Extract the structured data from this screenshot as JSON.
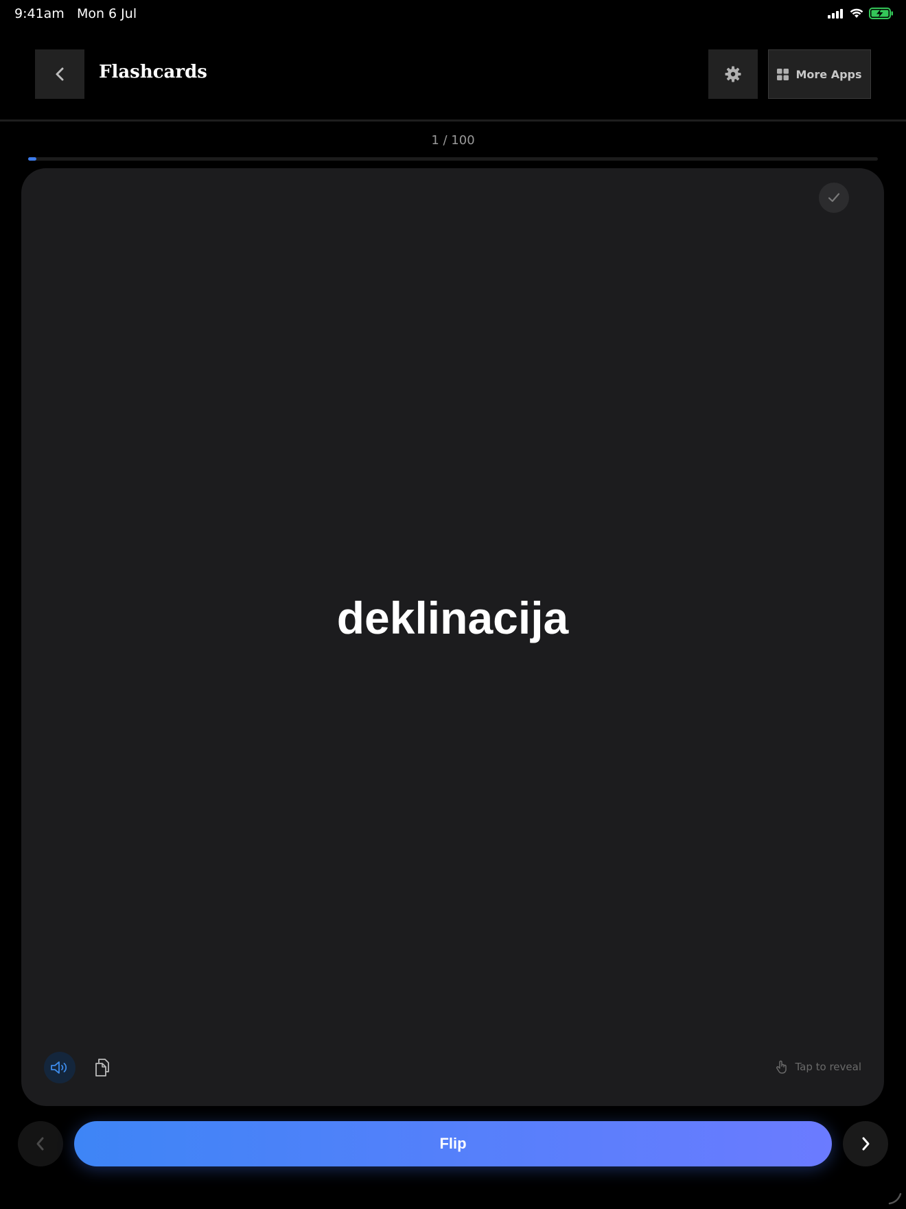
{
  "status_bar": {
    "time": "9:41am",
    "date": "Mon 6 Jul",
    "battery_color": "#34c759"
  },
  "header": {
    "title": "Flashcards",
    "more_apps_label": "More Apps"
  },
  "progress": {
    "label": "1 / 100",
    "current": 1,
    "total": 100,
    "fraction": 0.01,
    "color": "#3d7bea"
  },
  "card": {
    "word": "deklinacija",
    "hint": "Tap to reveal"
  },
  "bottom_nav": {
    "flip_label": "Flip",
    "accent_start": "#3e85f6",
    "accent_end": "#6b7bff"
  },
  "icons": {
    "back": "chevron-left-icon",
    "settings": "gear-icon",
    "more_apps": "grid-icon",
    "known": "checkmark-icon",
    "speak": "speaker-icon",
    "copy": "copy-icon",
    "hint": "tap-hand-icon",
    "prev": "chevron-left-icon",
    "next": "chevron-right-icon"
  }
}
